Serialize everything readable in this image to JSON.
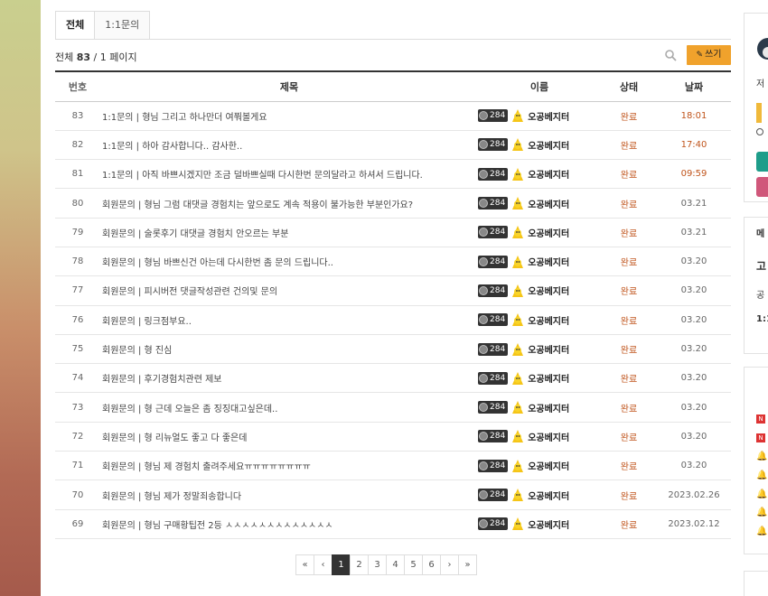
{
  "tabs": [
    "전체",
    "1:1문의"
  ],
  "count": {
    "prefix": "전체 ",
    "total": "83",
    "suffix": " / 1 페이지"
  },
  "write_label": "쓰기",
  "headers": {
    "num": "번호",
    "title": "제목",
    "name": "이름",
    "status": "상태",
    "date": "날짜"
  },
  "rows": [
    {
      "num": "83",
      "title": "1:1문의 | 형님 그리고 하나만더 여쭤볼게요",
      "level": "284",
      "name": "오공베지터",
      "status": "완료",
      "date": "18:01",
      "today": true
    },
    {
      "num": "82",
      "title": "1:1문의 | 하아 감사합니다.. 감사한..",
      "level": "284",
      "name": "오공베지터",
      "status": "완료",
      "date": "17:40",
      "today": true
    },
    {
      "num": "81",
      "title": "1:1문의 | 아직 바쁘시겠지만 조금 덜바쁘실때 다시한번 문의달라고 하셔서 드립니다.",
      "level": "284",
      "name": "오공베지터",
      "status": "완료",
      "date": "09:59",
      "today": true
    },
    {
      "num": "80",
      "title": "회원문의 | 형님 그럼 대댓글 경험치는 앞으로도 계속 적용이 불가능한 부분인가요?",
      "level": "284",
      "name": "오공베지터",
      "status": "완료",
      "date": "03.21",
      "today": false
    },
    {
      "num": "79",
      "title": "회원문의 | 술롯후기 대댓글 경험치 안오르는 부분",
      "level": "284",
      "name": "오공베지터",
      "status": "완료",
      "date": "03.21",
      "today": false
    },
    {
      "num": "78",
      "title": "회원문의 | 형님 바쁘신건 아는데 다시한번 좀 문의 드립니다..",
      "level": "284",
      "name": "오공베지터",
      "status": "완료",
      "date": "03.20",
      "today": false
    },
    {
      "num": "77",
      "title": "회원문의 | 피시버전 댓글작성관련 건의및 문의",
      "level": "284",
      "name": "오공베지터",
      "status": "완료",
      "date": "03.20",
      "today": false
    },
    {
      "num": "76",
      "title": "회원문의 | 링크점부요..",
      "level": "284",
      "name": "오공베지터",
      "status": "완료",
      "date": "03.20",
      "today": false
    },
    {
      "num": "75",
      "title": "회원문의 | 형 진심",
      "level": "284",
      "name": "오공베지터",
      "status": "완료",
      "date": "03.20",
      "today": false
    },
    {
      "num": "74",
      "title": "회원문의 | 후기경험치관련 제보",
      "level": "284",
      "name": "오공베지터",
      "status": "완료",
      "date": "03.20",
      "today": false
    },
    {
      "num": "73",
      "title": "회원문의 | 형 근데 오늘은 좀 징징대고싶은데..",
      "level": "284",
      "name": "오공베지터",
      "status": "완료",
      "date": "03.20",
      "today": false
    },
    {
      "num": "72",
      "title": "회원문의 | 형 리뉴얼도 좋고 다 좋은데",
      "level": "284",
      "name": "오공베지터",
      "status": "완료",
      "date": "03.20",
      "today": false
    },
    {
      "num": "71",
      "title": "회원문의 | 형님 제 경험치 출려주세요ㅠㅠㅠㅠㅠㅠㅠㅠ",
      "level": "284",
      "name": "오공베지터",
      "status": "완료",
      "date": "03.20",
      "today": false
    },
    {
      "num": "70",
      "title": "회원문의 | 형님 제가 정말죄송합니다",
      "level": "284",
      "name": "오공베지터",
      "status": "완료",
      "date": "2023.02.26",
      "today": false
    },
    {
      "num": "69",
      "title": "회원문의 | 형님 구매황팁전 2등 ㅅㅅㅅㅅㅅㅅㅅㅅㅅㅅㅅㅅㅅ",
      "level": "284",
      "name": "오공베지터",
      "status": "완료",
      "date": "2023.02.12",
      "today": false
    }
  ],
  "pagination": [
    "«",
    "‹",
    "1",
    "2",
    "3",
    "4",
    "5",
    "6",
    "›",
    "»"
  ],
  "pagination_active": "1",
  "right_panel": {
    "text1": "저",
    "text2": "메",
    "text3": "고",
    "text4": "공",
    "text5": "1:1"
  },
  "colors": {
    "accent": "#f0a22c",
    "status": "#c0541b",
    "header_border": "#333333"
  }
}
